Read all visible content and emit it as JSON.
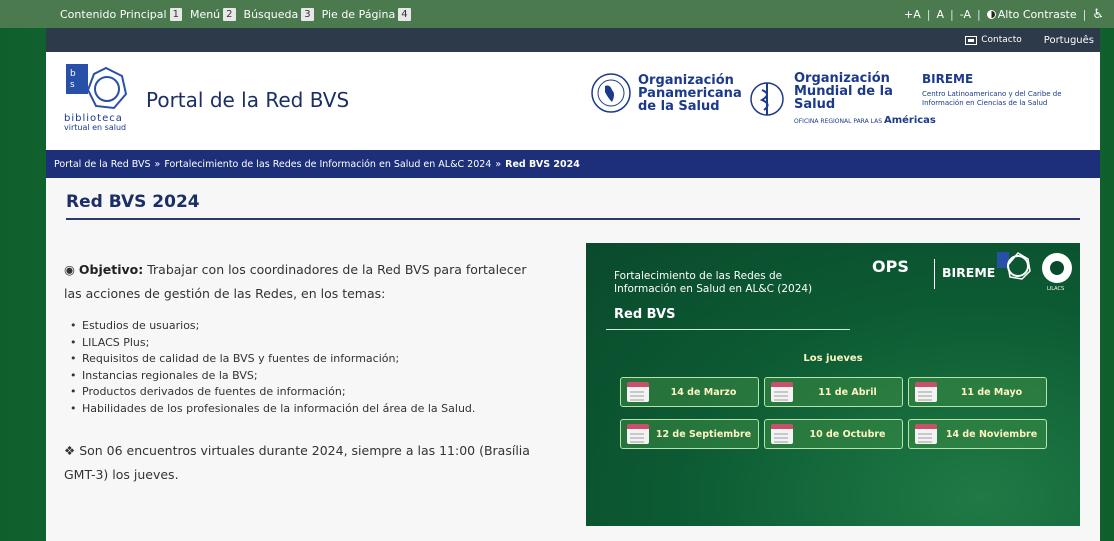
{
  "skip_links": [
    {
      "label": "Contenido Principal",
      "key": "1"
    },
    {
      "label": "Menú",
      "key": "2"
    },
    {
      "label": "Búsqueda",
      "key": "3"
    },
    {
      "label": "Pie de Página",
      "key": "4"
    }
  ],
  "accessibility": {
    "increase": "+A",
    "normal": "A",
    "decrease": "-A",
    "contrast": "Alto Contraste",
    "accessibility_icon": "♿"
  },
  "util": {
    "contact": "Contacto",
    "language": "Português"
  },
  "header": {
    "site_title": "Portal de la Red BVS",
    "bvs_caption_1": "biblioteca",
    "bvs_caption_2": "virtual en salud",
    "opas": "Organización Panamericana de la Salud",
    "oms": "Organización Mundial de la Salud",
    "oms_sub": "Américas",
    "oms_tiny": "OFICINA REGIONAL PARA LAS",
    "bireme": "BIREME",
    "bireme_sub": "Centro Latinoamericano y del Caribe de Información en Ciencias de la Salud"
  },
  "breadcrumb": {
    "items": [
      "Portal de la Red BVS",
      "Fortalecimiento de las Redes de Información en Salud en AL&C 2024"
    ],
    "current": "Red BVS 2024",
    "separator": "»"
  },
  "main": {
    "title": "Red BVS 2024",
    "objective_label": "Objetivo:",
    "objective_text": "Trabajar con los coordinadores de la Red BVS para fortalecer las acciones de gestión de las Redes, en los temas:",
    "topics": [
      "Estudios de usuarios;",
      "LILACS Plus;",
      "Requisitos de calidad de la BVS y fuentes de información;",
      "Instancias regionales de la BVS;",
      "Productos derivados de fuentes de información;",
      "Habilidades de los profesionales de la información del área de la Salud."
    ],
    "meetings_text": "Son 06 encuentros virtuales durante 2024, siempre a las 11:00 (Brasília GMT-3) los jueves."
  },
  "banner": {
    "subtitle": "Fortalecimiento de las Redes de Información en Salud en AL&C (2024)",
    "title": "Red BVS",
    "ops": "OPS",
    "bireme": "BIREME",
    "lilacs": "LILACS",
    "weekday": "Los jueves",
    "dates": [
      "14 de Marzo",
      "11 de Abril",
      "11 de Mayo",
      "12 de Septiembre",
      "10 de Octubre",
      "14 de Noviembre"
    ]
  }
}
